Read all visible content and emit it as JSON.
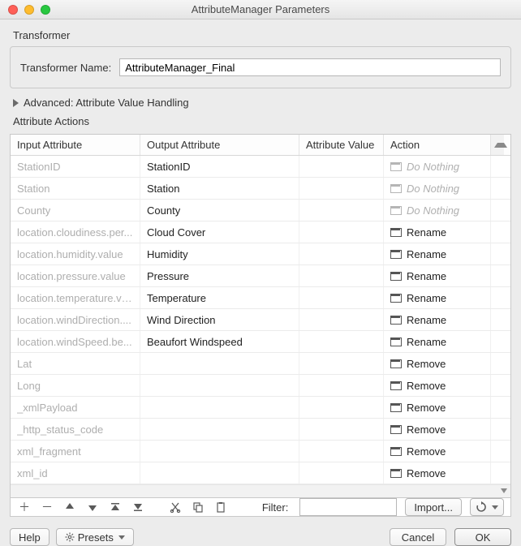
{
  "window": {
    "title": "AttributeManager Parameters"
  },
  "transformer": {
    "section_label": "Transformer",
    "name_label": "Transformer Name:",
    "name_value": "AttributeManager_Final"
  },
  "advanced": {
    "label": "Advanced: Attribute Value Handling"
  },
  "attribute_actions": {
    "section_label": "Attribute Actions",
    "columns": {
      "input": "Input Attribute",
      "output": "Output Attribute",
      "value": "Attribute Value",
      "action": "Action"
    },
    "rows": [
      {
        "input": "StationID",
        "output": "StationID",
        "value": "",
        "action": "Do Nothing",
        "muted": true
      },
      {
        "input": "Station",
        "output": "Station",
        "value": "",
        "action": "Do Nothing",
        "muted": true
      },
      {
        "input": "County",
        "output": "County",
        "value": "",
        "action": "Do Nothing",
        "muted": true
      },
      {
        "input": "location.cloudiness.per...",
        "output": "Cloud Cover",
        "value": "",
        "action": "Rename",
        "muted": false
      },
      {
        "input": "location.humidity.value",
        "output": "Humidity",
        "value": "",
        "action": "Rename",
        "muted": false
      },
      {
        "input": "location.pressure.value",
        "output": "Pressure",
        "value": "",
        "action": "Rename",
        "muted": false
      },
      {
        "input": "location.temperature.va...",
        "output": "Temperature",
        "value": "",
        "action": "Rename",
        "muted": false
      },
      {
        "input": "location.windDirection....",
        "output": "Wind Direction",
        "value": "",
        "action": "Rename",
        "muted": false
      },
      {
        "input": "location.windSpeed.be...",
        "output": "Beaufort Windspeed",
        "value": "",
        "action": "Rename",
        "muted": false
      },
      {
        "input": "Lat",
        "output": "",
        "value": "",
        "action": "Remove",
        "muted": false
      },
      {
        "input": "Long",
        "output": "",
        "value": "",
        "action": "Remove",
        "muted": false
      },
      {
        "input": "_xmlPayload",
        "output": "",
        "value": "",
        "action": "Remove",
        "muted": false
      },
      {
        "input": "_http_status_code",
        "output": "",
        "value": "",
        "action": "Remove",
        "muted": false
      },
      {
        "input": "xml_fragment",
        "output": "",
        "value": "",
        "action": "Remove",
        "muted": false
      },
      {
        "input": "xml_id",
        "output": "",
        "value": "",
        "action": "Remove",
        "muted": false
      }
    ]
  },
  "toolbar": {
    "filter_label": "Filter:",
    "filter_value": "",
    "import_label": "Import..."
  },
  "footer": {
    "help": "Help",
    "presets": "Presets",
    "cancel": "Cancel",
    "ok": "OK"
  }
}
